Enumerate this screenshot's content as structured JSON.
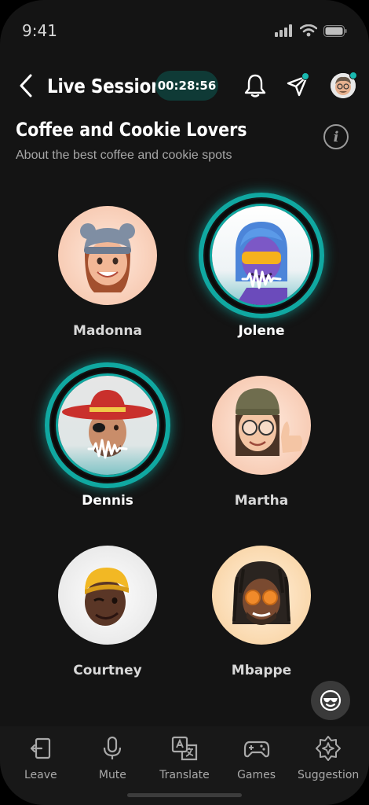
{
  "status": {
    "time": "9:41"
  },
  "header": {
    "title": "Live Session",
    "timer": "00:28:56"
  },
  "room": {
    "title": "Coffee and Cookie Lovers",
    "subtitle": "About the best coffee and cookie spots",
    "info_glyph": "i"
  },
  "participants": [
    {
      "name": "Madonna",
      "speaking": false
    },
    {
      "name": "Jolene",
      "speaking": true
    },
    {
      "name": "Dennis",
      "speaking": true
    },
    {
      "name": "Martha",
      "speaking": false
    },
    {
      "name": "Courtney",
      "speaking": false
    },
    {
      "name": "Mbappe",
      "speaking": false
    }
  ],
  "nav": [
    {
      "label": "Leave",
      "icon": "leave-icon"
    },
    {
      "label": "Mute",
      "icon": "microphone-icon"
    },
    {
      "label": "Translate",
      "icon": "translate-icon"
    },
    {
      "label": "Games",
      "icon": "gamepad-icon"
    },
    {
      "label": "Suggestion",
      "icon": "sparkle-icon"
    }
  ],
  "colors": {
    "accent": "#10a8a1",
    "background": "#141414",
    "timer_bg": "#0f3a36"
  }
}
